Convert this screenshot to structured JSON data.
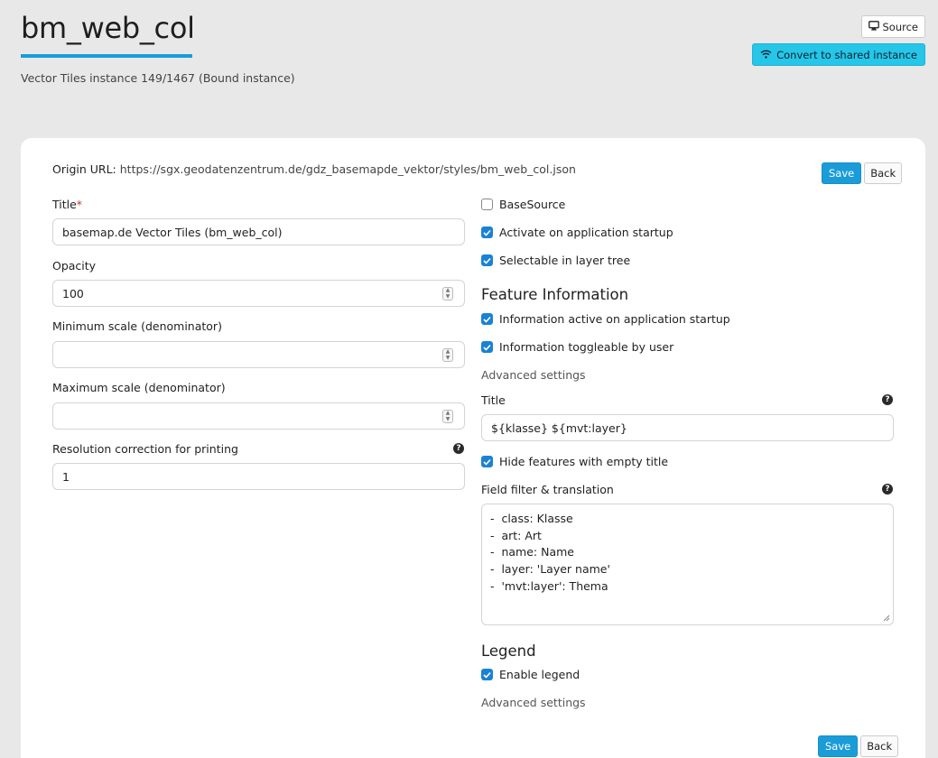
{
  "header": {
    "title": "bm_web_col",
    "subtitle": "Vector Tiles instance 149/1467 (Bound instance)",
    "source_label": "Source",
    "convert_label": "Convert to shared instance",
    "accent_color": "#1a9cd8",
    "convert_color": "#26c6e8"
  },
  "form": {
    "origin_label": "Origin URL:",
    "origin_url": "https://sgx.geodatenzentrum.de/gdz_basemapde_vektor/styles/bm_web_col.json",
    "save_label": "Save",
    "back_label": "Back",
    "title_label": "Title",
    "title_required": "*",
    "title_value": "basemap.de Vector Tiles (bm_web_col)",
    "opacity_label": "Opacity",
    "opacity_value": "100",
    "min_scale_label": "Minimum scale (denominator)",
    "min_scale_value": "",
    "max_scale_label": "Maximum scale (denominator)",
    "max_scale_value": "",
    "resolution_label": "Resolution correction for printing",
    "resolution_value": "1",
    "basesource_label": "BaseSource",
    "basesource_checked": false,
    "activate_label": "Activate on application startup",
    "activate_checked": true,
    "selectable_label": "Selectable in layer tree",
    "selectable_checked": true
  },
  "feature_info": {
    "heading": "Feature Information",
    "active_label": "Information active on application startup",
    "active_checked": true,
    "toggleable_label": "Information toggleable by user",
    "toggleable_checked": true,
    "advanced_label": "Advanced settings",
    "title_label": "Title",
    "title_value": "${klasse}  ${mvt:layer}",
    "hide_empty_label": "Hide features with empty title",
    "hide_empty_checked": true,
    "filter_label": "Field filter & translation",
    "filter_lines": [
      "-  class: Klasse",
      "-  art: Art",
      "-  name: Name",
      "-  layer: 'Layer name'",
      "-  'mvt:layer': Thema"
    ]
  },
  "legend": {
    "heading": "Legend",
    "enable_label": "Enable legend",
    "enable_checked": true,
    "advanced_label": "Advanced settings"
  },
  "icons": {
    "source": "monitor-icon",
    "convert": "wifi-icon",
    "help": "question-circle-icon",
    "check": "checkmark-icon"
  }
}
